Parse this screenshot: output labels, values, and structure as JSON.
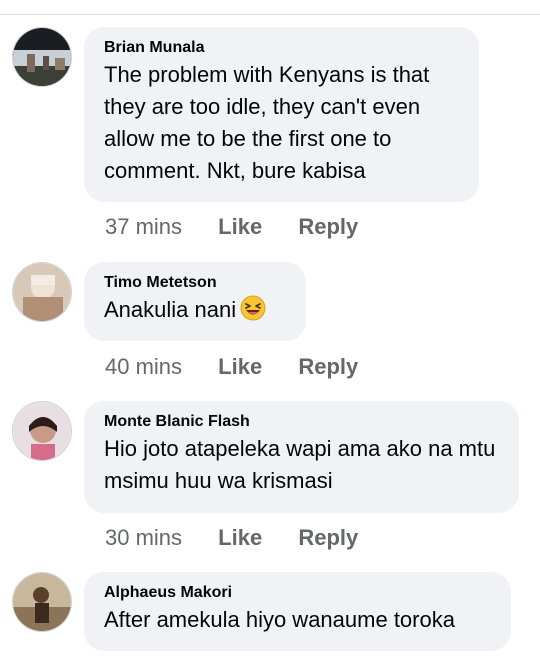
{
  "comments": [
    {
      "author": "Brian Munala",
      "text": "The problem with Kenyans is that they are too idle, they can't even allow me to be the first one to comment. Nkt, bure kabisa",
      "time": "37 mins",
      "like_label": "Like",
      "reply_label": "Reply"
    },
    {
      "author": "Timo Metetson",
      "text": "Anakulia nani",
      "emoji": "laughing-face-emoji",
      "time": "40 mins",
      "like_label": "Like",
      "reply_label": "Reply"
    },
    {
      "author": "Monte Blanic Flash",
      "text": "Hio joto atapeleka  wapi  ama ako na mtu msimu  huu wa krismasi",
      "time": "30 mins",
      "like_label": "Like",
      "reply_label": "Reply"
    },
    {
      "author": "Alphaeus Makori",
      "text": "After amekula hiyo wanaume toroka"
    }
  ],
  "colors": {
    "bubble": "#f0f2f5",
    "meta_text": "#65676b",
    "text": "#050505"
  }
}
